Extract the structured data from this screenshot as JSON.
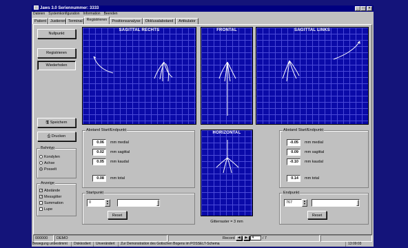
{
  "window": {
    "title": "Jaws 3.0  Seriennummer: 3333"
  },
  "menu": [
    "Dateien",
    "Systemkonfiguration",
    "Information",
    "Beenden"
  ],
  "tabs": [
    "Patient",
    "Justieren",
    "Terminal",
    "Registrieren",
    "Positionsanalyse",
    "Okklusalabstand",
    "Artikulator"
  ],
  "active_tab": "Registrieren",
  "buttons": {
    "nullpunkt": "Nullpunkt",
    "registrieren": "Registrieren",
    "wiederholen": "Wiederholen",
    "speichern": "Speichern",
    "drucken": "Drucken"
  },
  "panels": {
    "sag_rechts": "SAGITTAL RECHTS",
    "frontal": "FRONTAL",
    "sag_links": "SAGITTAL LINKS",
    "horizontal": "HORIZONTAL",
    "gitter": "Gitterraster = 3 mm"
  },
  "bahntyp": {
    "title": "Bahntyp",
    "options": [
      "Kondylen",
      "Achse",
      "Posselt"
    ],
    "selected": "Posselt"
  },
  "anzeige": {
    "title": "Anzeige",
    "options": [
      "Abstände",
      "Messgitter",
      "Summation",
      "Lupe"
    ],
    "checked": [
      true,
      true,
      false,
      false
    ]
  },
  "abstand_rechts": {
    "title": "Abstand Start/Endpunkt",
    "rows": [
      {
        "value": "0.06",
        "label": "mm medial"
      },
      {
        "value": "0.02",
        "label": "mm sagittal"
      },
      {
        "value": "0.05",
        "label": "mm kaudal"
      }
    ],
    "total": {
      "value": "0.08",
      "label": "mm total"
    }
  },
  "abstand_links": {
    "title": "Abstand Start/Endpunkt",
    "rows": [
      {
        "value": "-0.05",
        "label": "mm medial"
      },
      {
        "value": "0.09",
        "label": "mm sagittal"
      },
      {
        "value": "-0.10",
        "label": "mm kaudal"
      }
    ],
    "total": {
      "value": "0.14",
      "label": "mm total"
    }
  },
  "startpunkt": {
    "title": "Startpunkt",
    "value": "0",
    "reset": "Reset"
  },
  "endpunkt": {
    "title": "Endpunkt",
    "value": "767",
    "reset": "Reset"
  },
  "status_row": {
    "id": "000000",
    "name": "DEMO",
    "record_label": "Record",
    "record_value": "4",
    "record_total": "/ 7"
  },
  "statusbar": [
    "Bewegung unbestimmt",
    "Diskkodiert",
    "Unverändert",
    "Zur Demonstration des Gotischen Bogens im POSSELT-Schema",
    "13:09:03"
  ],
  "colors": {
    "grid_bg": "#0a0aa8",
    "grid_lines": "#4a4ad8",
    "titlebar": "#000080",
    "desktop": "#14147a"
  }
}
